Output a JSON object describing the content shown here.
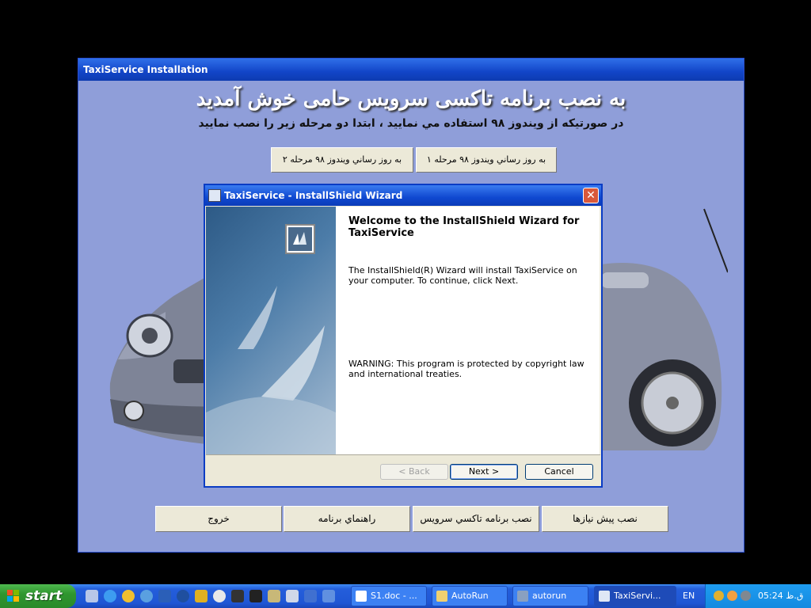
{
  "installer": {
    "title": "TaxiService Installation",
    "heading": "به نصب برنامه تاکسی سرویس حامی خوش آمدید",
    "subheading": "در صورتیکه از ویندوز ۹۸ استفاده مي نماييد ، ابتدا دو مرحله زير را نصب نماييد",
    "top_buttons": [
      "به روز رساني ويندوز ۹۸ مرحله ۱",
      "به روز رساني ويندوز ۹۸ مرحله ۲"
    ],
    "bottom_buttons": [
      "نصب پيش نيازها",
      "نصب برنامه تاکسي سرويس",
      "راهنماي برنامه",
      "خروج"
    ]
  },
  "wizard": {
    "title": "TaxiService - InstallShield Wizard",
    "close": "✕",
    "heading": "Welcome to the InstallShield Wizard for TaxiService",
    "body": "The InstallShield(R) Wizard will install TaxiService on your computer. To continue, click Next.",
    "warning": "WARNING: This program is protected by copyright law and international treaties.",
    "buttons": {
      "back": "< Back",
      "next": "Next >",
      "cancel": "Cancel"
    }
  },
  "taskbar": {
    "start": "start",
    "tasks": [
      "S1.doc - ...",
      "AutoRun",
      "autorun",
      "TaxiServi..."
    ],
    "language": "EN",
    "clock": "05:24 ق.ظ",
    "quick_launch_icons": [
      "show-desktop-icon",
      "ie-icon",
      "messenger-icon",
      "firefox-icon",
      "word-icon",
      "acrobat-icon",
      "winamp-icon",
      "media-icon",
      "tool-icon",
      "folder-icon",
      "network-icon",
      "window-icon",
      "app-icon"
    ]
  },
  "colors": {
    "desktop_bg": "#000000",
    "installer_bg": "#8f9ed9",
    "title_blue": "#1245c8",
    "taskbar_blue": "#245edb",
    "start_green": "#2f962f"
  }
}
